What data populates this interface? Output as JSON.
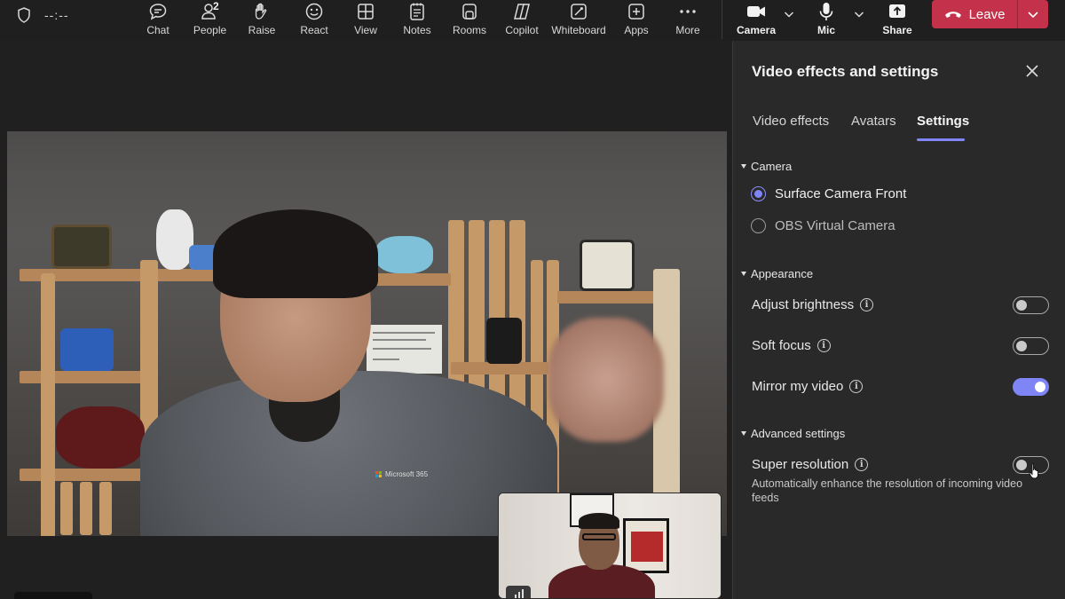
{
  "toolbar": {
    "timer": "--:--",
    "people_count": "2",
    "buttons": [
      {
        "label": "Chat",
        "icon": "chat-icon"
      },
      {
        "label": "People",
        "icon": "people-icon"
      },
      {
        "label": "Raise",
        "icon": "raise-hand-icon"
      },
      {
        "label": "React",
        "icon": "react-icon"
      },
      {
        "label": "View",
        "icon": "view-icon"
      },
      {
        "label": "Notes",
        "icon": "notes-icon"
      },
      {
        "label": "Rooms",
        "icon": "rooms-icon"
      },
      {
        "label": "Copilot",
        "icon": "copilot-icon"
      },
      {
        "label": "Whiteboard",
        "icon": "whiteboard-icon"
      },
      {
        "label": "Apps",
        "icon": "apps-icon"
      },
      {
        "label": "More",
        "icon": "more-icon"
      }
    ],
    "camera_label": "Camera",
    "mic_label": "Mic",
    "share_label": "Share",
    "leave_label": "Leave"
  },
  "video": {
    "main_shirt_text": "Microsoft 365"
  },
  "panel": {
    "title": "Video effects and settings",
    "tabs": [
      "Video effects",
      "Avatars",
      "Settings"
    ],
    "active_tab": "Settings",
    "camera": {
      "section_label": "Camera",
      "options": [
        "Surface Camera Front",
        "OBS Virtual Camera"
      ],
      "selected": "Surface Camera Front"
    },
    "appearance": {
      "section_label": "Appearance",
      "adjust_brightness": {
        "label": "Adjust brightness",
        "on": false
      },
      "soft_focus": {
        "label": "Soft focus",
        "on": false
      },
      "mirror_video": {
        "label": "Mirror my video",
        "on": true
      }
    },
    "advanced": {
      "section_label": "Advanced settings",
      "super_resolution": {
        "label": "Super resolution",
        "on": false
      },
      "super_resolution_desc": "Automatically enhance the resolution of incoming video feeds"
    }
  },
  "colors": {
    "accent": "#7f85f5",
    "leave": "#c4314b",
    "panel_bg": "#292929",
    "toolbar_bg": "#1f1f1f"
  }
}
